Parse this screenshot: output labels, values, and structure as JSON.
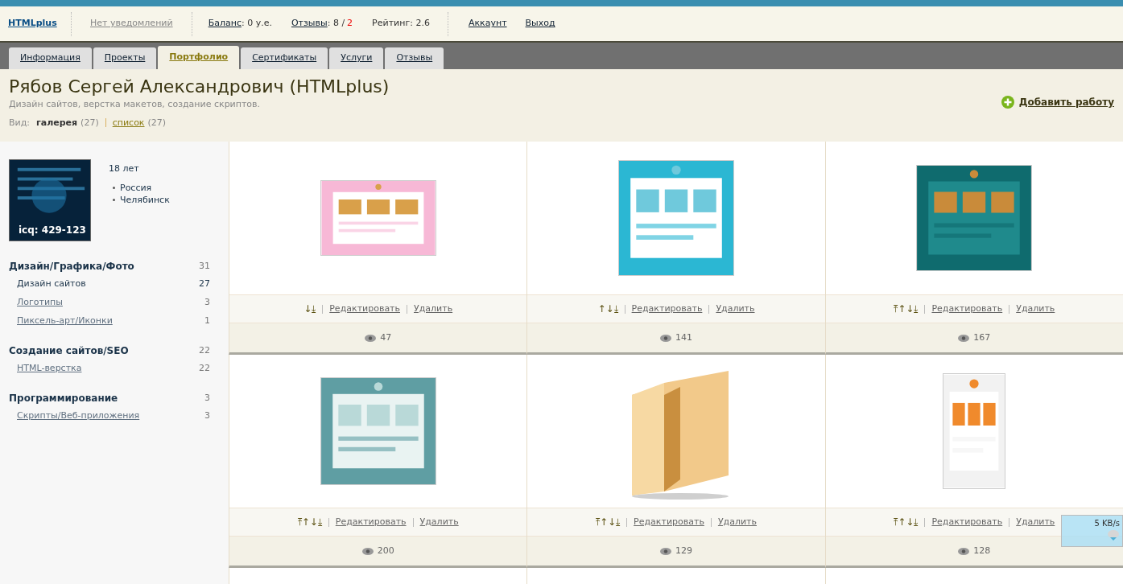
{
  "header": {
    "logo": "HTMLplus",
    "notifications": "Нет уведомлений",
    "balance_label": "Баланс",
    "balance_value": ": 0 у.е.",
    "reviews_label": "Отзывы",
    "reviews_positive": ": 8 /",
    "reviews_negative": "2",
    "rating": "Рейтинг: 2.6",
    "account": "Аккаунт",
    "logout": "Выход"
  },
  "tabs": [
    {
      "label": "Информация",
      "selected": false
    },
    {
      "label": "Проекты",
      "selected": false
    },
    {
      "label": "Портфолио",
      "selected": true
    },
    {
      "label": "Сертификаты",
      "selected": false
    },
    {
      "label": "Услуги",
      "selected": false
    },
    {
      "label": "Отзывы",
      "selected": false
    }
  ],
  "profile": {
    "name": "Рябов Сергей Александрович (HTMLplus)",
    "specialization": "Дизайн сайтов, верстка макетов, создание скриптов.",
    "view_label": "Вид:",
    "views": [
      {
        "label": "галерея",
        "count": "(27)",
        "selected": true
      },
      {
        "label": "список",
        "count": "(27)",
        "selected": false
      }
    ],
    "add_work": "Добавить работу"
  },
  "sidebar": {
    "avatar_caption": "icq: 429-123",
    "age": "18 лет",
    "location": [
      "Россия",
      "Челябинск"
    ],
    "categories": [
      {
        "title": "Дизайн/Графика/Фото",
        "count": "31",
        "children": [
          {
            "label": "Дизайн сайтов",
            "count": "27",
            "selected": true
          },
          {
            "label": "Логотипы",
            "count": "3",
            "selected": false
          },
          {
            "label": "Пиксель-арт/Иконки",
            "count": "1",
            "selected": false
          }
        ]
      },
      {
        "title": "Создание сайтов/SEO",
        "count": "22",
        "children": [
          {
            "label": "HTML-верстка",
            "count": "22",
            "selected": false
          }
        ]
      },
      {
        "title": "Программирование",
        "count": "3",
        "children": [
          {
            "label": "Скрипты/Веб-приложения",
            "count": "3",
            "selected": false
          }
        ]
      }
    ]
  },
  "works": [
    {
      "kind": "pink",
      "sort": "↓⤓",
      "edit": "Редактировать",
      "delete": "Удалить",
      "views": "47"
    },
    {
      "kind": "cyan",
      "sort": "↑↓⤓",
      "edit": "Редактировать",
      "delete": "Удалить",
      "views": "141"
    },
    {
      "kind": "teal",
      "sort": "⤒↑↓⤓",
      "edit": "Редактировать",
      "delete": "Удалить",
      "views": "167"
    },
    {
      "kind": "sea",
      "sort": "⤒↑↓⤓",
      "edit": "Редактировать",
      "delete": "Удалить",
      "views": "200"
    },
    {
      "kind": "folder",
      "sort": "⤒↑↓⤓",
      "edit": "Редактировать",
      "delete": "Удалить",
      "views": "129"
    },
    {
      "kind": "fruit",
      "sort": "⤒↑↓⤓",
      "edit": "Редактировать",
      "delete": "Удалить",
      "views": "128"
    }
  ],
  "speed_widget": {
    "reading": "5 KB/s"
  }
}
